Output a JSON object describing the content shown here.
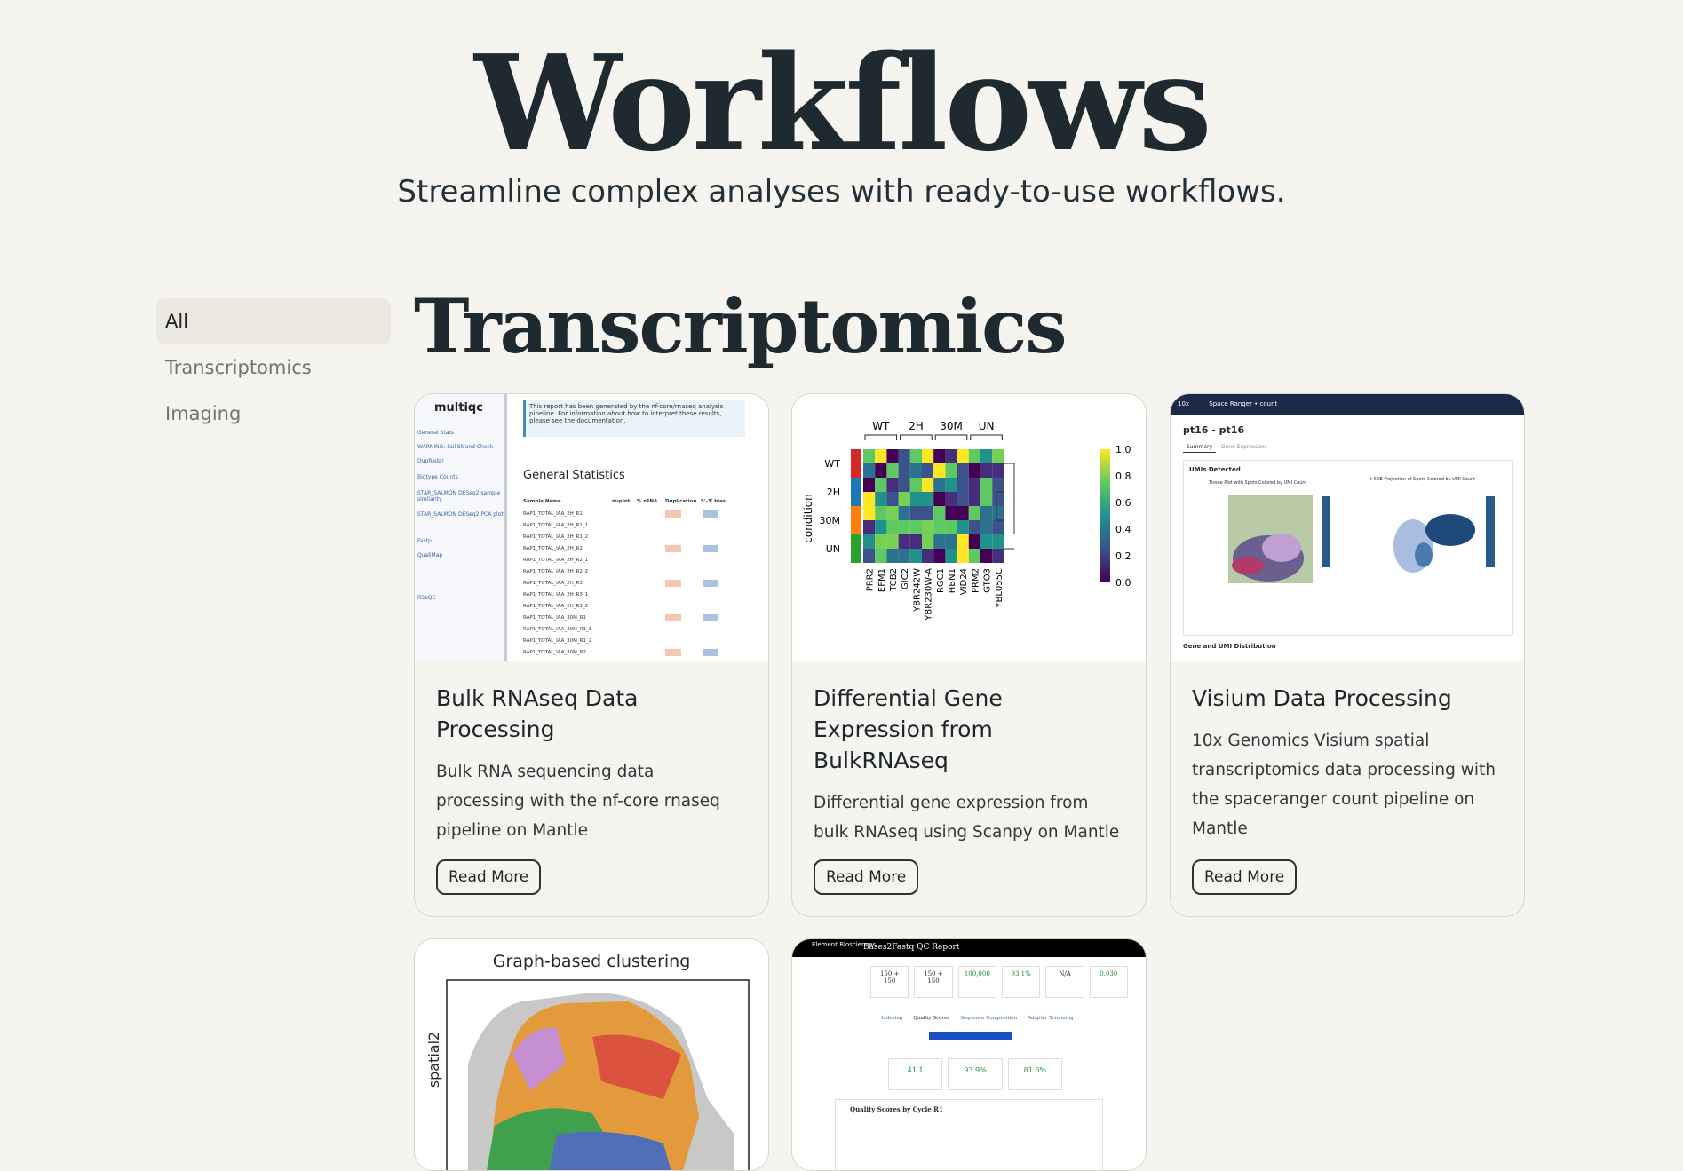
{
  "hero": {
    "title": "Workflows",
    "subtitle": "Streamline complex analyses with ready-to-use workflows."
  },
  "sidebar": {
    "items": [
      {
        "label": "All",
        "active": true
      },
      {
        "label": "Transcriptomics",
        "active": false
      },
      {
        "label": "Imaging",
        "active": false
      }
    ]
  },
  "section": {
    "title": "Transcriptomics"
  },
  "cards": [
    {
      "title": "Bulk RNAseq Data Processing",
      "description": "Bulk RNA sequencing data processing with the nf-core rnaseq pipeline on Mantle",
      "button": "Read More",
      "thumb": {
        "logo": "multiqc",
        "banner": "This report has been generated by the nf-core/rnaseq analysis pipeline. For information about how to interpret these results, please see the documentation.",
        "heading": "General Statistics",
        "nav": [
          "General Stats",
          "WARNING: Fail Strand Check",
          "DupRadar",
          "Biotype Counts",
          "STAR_SALMON DESeq2 sample similarity",
          "STAR_SALMON DESeq2 PCA plot",
          "Fastp",
          "QualiMap",
          "RSeQC"
        ],
        "columns": [
          "Sample Name",
          "dupInt",
          "% rRNA",
          "Duplication",
          "5'-3' bias"
        ],
        "rows": [
          "RAP1_TOTAL_IAA_2H_R1",
          "RAP1_TOTAL_IAA_2H_R1_1",
          "RAP1_TOTAL_IAA_2H_R1_2",
          "RAP1_TOTAL_IAA_2H_R2",
          "RAP1_TOTAL_IAA_2H_R2_1",
          "RAP1_TOTAL_IAA_2H_R2_2",
          "RAP1_TOTAL_IAA_2H_R3",
          "RAP1_TOTAL_IAA_2H_R3_1",
          "RAP1_TOTAL_IAA_2H_R3_2",
          "RAP1_TOTAL_IAA_30M_R1",
          "RAP1_TOTAL_IAA_30M_R1_1",
          "RAP1_TOTAL_IAA_30M_R1_2",
          "RAP1_TOTAL_IAA_30M_R2"
        ]
      }
    },
    {
      "title": "Differential Gene Expression from BulkRNAseq",
      "description": "Differential gene expression from bulk RNAseq using Scanpy on Mantle",
      "button": "Read More",
      "thumb": {
        "groups": [
          "WT",
          "2H",
          "30M",
          "UN"
        ],
        "ylabel": "condition",
        "genes": [
          "PRR2",
          "EFM1",
          "TCB2",
          "GIC2",
          "YBR242W",
          "YBR230W-A",
          "RGC1",
          "HBN1",
          "VID24",
          "PRM2",
          "GTO3",
          "YBL055C"
        ],
        "colorbar_ticks": [
          "1.0",
          "0.8",
          "0.6",
          "0.4",
          "0.2",
          "0.0"
        ]
      }
    },
    {
      "title": "Visium Data Processing",
      "description": "10x Genomics Visium spatial transcriptomics data processing with the spaceranger count pipeline on Mantle",
      "button": "Read More",
      "thumb": {
        "brand": "10x",
        "bar": "Space Ranger • count",
        "sample": "pt16 - pt16",
        "tabs": [
          "Summary",
          "Gene Expression"
        ],
        "panel": "UMIs Detected",
        "plot1": "Tissue Plot with Spots Colored by UMI Count",
        "plot2": "t-SNE Projection of Spots Colored by UMI Count",
        "footer": "Gene and UMI Distribution"
      }
    },
    {
      "title": "",
      "description": "",
      "thumb": {
        "heading": "Graph-based clustering",
        "ylabel": "spatial2"
      }
    },
    {
      "title": "",
      "description": "",
      "thumb": {
        "brand": "Element Biosciences",
        "heading": "Bases2Fastq QC Report",
        "stats": [
          "150 + 150",
          "150 + 150",
          "100,000",
          "93.1%",
          "N/A",
          "0.030"
        ],
        "tabs": [
          "Indexing",
          "Quality Scores",
          "Sequence Composition",
          "Adapter Trimming"
        ],
        "metrics": [
          "41.1",
          "93.9%",
          "81.6%"
        ],
        "chart_title": "Quality Scores by Cycle R1"
      }
    }
  ]
}
